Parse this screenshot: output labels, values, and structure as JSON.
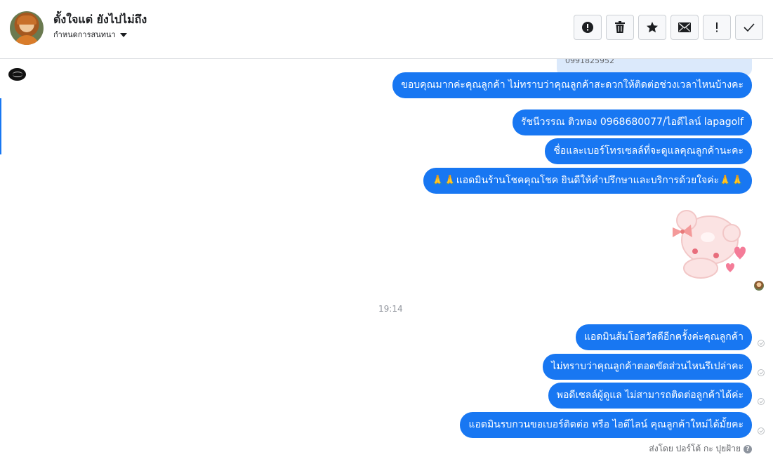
{
  "header": {
    "contact_name": "ตั้งใจแต่ ยังไปไม่ถึง",
    "assign_label": "กำหนดการสนทนา",
    "actions": [
      {
        "name": "alert-circle-icon"
      },
      {
        "name": "trash-icon"
      },
      {
        "name": "star-icon"
      },
      {
        "name": "envelope-icon"
      },
      {
        "name": "exclamation-icon"
      },
      {
        "name": "checkmark-icon"
      }
    ]
  },
  "conversation": {
    "peek_text": "0991825952",
    "messages_block1": [
      "ขอบคุณมากค่ะคุณลูกค้า ไม่ทราบว่าคุณลูกค้าสะดวกให้ติดต่อช่วงเวลาไหนบ้างคะ",
      "รัชนีวรรณ ติวทอง    0968680077/ไอดีไลน์ lapagolf",
      "ชื่อและเบอร์โทรเซลล์ที่จะดูแลคุณลูกค้านะคะ",
      "🙏🙏แอดมินร้านโชคคุณโชค ยินดีให้คำปรึกษาและบริการด้วยใจค่ะ🙏🙏"
    ],
    "timestamp": "19:14",
    "messages_block2": [
      "แอดมินส้มโอสวัสดีอีกครั้งค่ะคุณลูกค้า",
      "ไม่ทราบว่าคุณลูกค้าตอดขัดส่วนไหนรึเปล่าคะ",
      "พอดีเซลล์ผู้ดูแล ไม่สามารถติดต่อลูกค้าได้ค่ะ",
      "แอดมินรบกวนขอเบอร์ติดต่อ หรือ ไอดีไลน์ คุณลูกค้าใหม่ได้มั้ยคะ"
    ],
    "sent_by": "ส่งโดย ปอร์โต้ กะ ปุยฝ้าย",
    "accent_color": "#1877f2"
  }
}
